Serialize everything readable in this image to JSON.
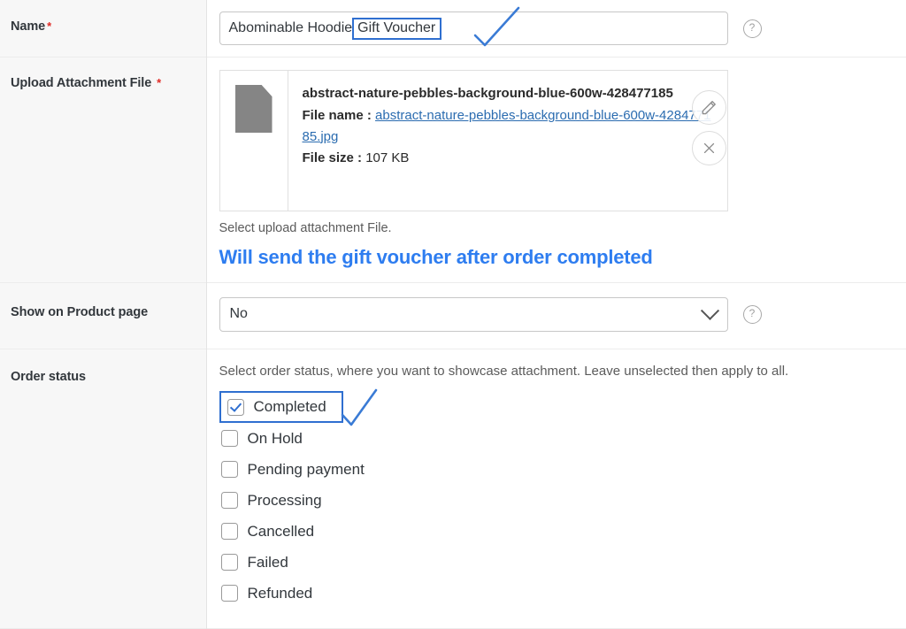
{
  "rows": {
    "name": {
      "label": "Name",
      "required": true,
      "input_value_plain": "Abominable Hoodie",
      "input_value_highlighted": "Gift Voucher",
      "help_icon": "question-circle-icon"
    },
    "attachment": {
      "label": "Upload Attachment File",
      "required": true,
      "file_title": "abstract-nature-pebbles-background-blue-600w-428477185",
      "file_name_label": "File name :",
      "file_name_value": "abstract-nature-pebbles-background-blue-600w-428477185.jpg",
      "file_size_label": "File size :",
      "file_size_value": "107 KB",
      "thumb_icon": "document-file-icon",
      "edit_icon": "pencil-icon",
      "remove_icon": "close-x-icon",
      "helper_text": "Select upload attachment File.",
      "annotation": "Will send the gift voucher after order completed"
    },
    "show_on_product": {
      "label": "Show on Product page",
      "required": false,
      "selected_value": "No",
      "chevron_icon": "chevron-down-icon",
      "help_icon": "question-circle-icon"
    },
    "order_status": {
      "label": "Order status",
      "required": false,
      "hint": "Select order status, where you want to showcase attachment. Leave unselected then apply to all.",
      "options": [
        {
          "label": "Completed",
          "checked": true,
          "highlighted": true
        },
        {
          "label": "On Hold",
          "checked": false,
          "highlighted": false
        },
        {
          "label": "Pending payment",
          "checked": false,
          "highlighted": false
        },
        {
          "label": "Processing",
          "checked": false,
          "highlighted": false
        },
        {
          "label": "Cancelled",
          "checked": false,
          "highlighted": false
        },
        {
          "label": "Failed",
          "checked": false,
          "highlighted": false
        },
        {
          "label": "Refunded",
          "checked": false,
          "highlighted": false
        }
      ]
    }
  },
  "colors": {
    "annotation_blue": "#2e7df0",
    "highlight_border": "#2f6fd0",
    "required_red": "#e02b26",
    "link_blue": "#2b6cb0",
    "label_bg": "#f7f7f7"
  }
}
